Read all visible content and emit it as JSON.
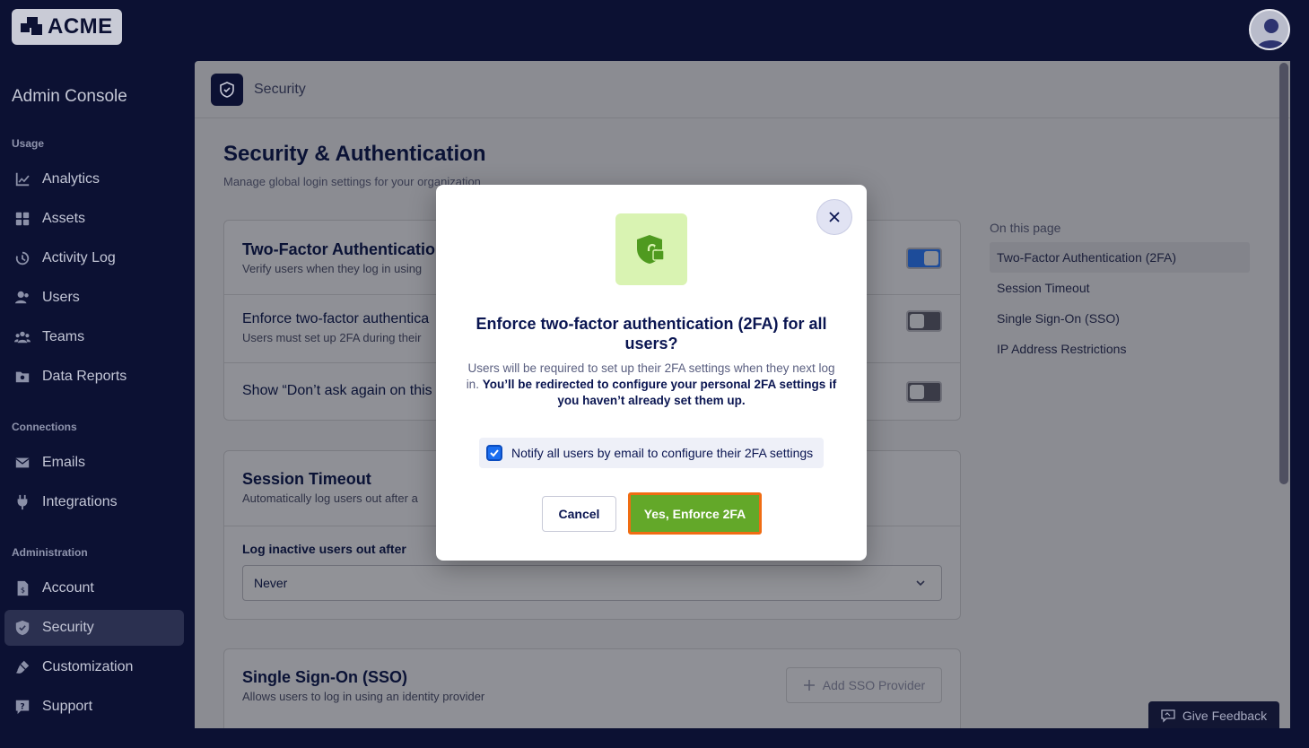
{
  "brand": {
    "logo_text": "ACME"
  },
  "sidebar": {
    "title": "Admin Console",
    "sections": [
      {
        "label": "Usage"
      },
      {
        "label": "Connections"
      },
      {
        "label": "Administration"
      }
    ],
    "items": [
      {
        "label": "Analytics",
        "icon": "chart-line-icon"
      },
      {
        "label": "Assets",
        "icon": "grid-icon"
      },
      {
        "label": "Activity Log",
        "icon": "history-icon"
      },
      {
        "label": "Users",
        "icon": "user-icon"
      },
      {
        "label": "Teams",
        "icon": "team-icon"
      },
      {
        "label": "Data Reports",
        "icon": "report-icon"
      },
      {
        "label": "Emails",
        "icon": "mail-icon"
      },
      {
        "label": "Integrations",
        "icon": "plug-icon"
      },
      {
        "label": "Account",
        "icon": "document-icon"
      },
      {
        "label": "Security",
        "icon": "shield-icon",
        "active": true
      },
      {
        "label": "Customization",
        "icon": "brush-icon"
      },
      {
        "label": "Support",
        "icon": "help-icon"
      }
    ]
  },
  "main": {
    "header_title": "Security",
    "page_title": "Security & Authentication",
    "page_subtitle": "Manage global login settings for your organization",
    "tfa": {
      "title": "Two-Factor Authentication",
      "subtitle": "Verify users when they log in using",
      "enforce_title": "Enforce two-factor authentica",
      "enforce_sub": "Users must set up 2FA during their",
      "show_title": "Show “Don’t ask again on this"
    },
    "session": {
      "title": "Session Timeout",
      "subtitle": "Automatically log users out after a",
      "field_label": "Log inactive users out after",
      "field_value": "Never"
    },
    "sso": {
      "title": "Single Sign-On (SSO)",
      "subtitle": "Allows users to log in using an identity provider",
      "add_button": "Add SSO Provider"
    }
  },
  "toc": {
    "label": "On this page",
    "items": [
      "Two-Factor Authentication (2FA)",
      "Session Timeout",
      "Single Sign-On (SSO)",
      "IP Address Restrictions"
    ]
  },
  "feedback": {
    "label": "Give Feedback"
  },
  "modal": {
    "title": "Enforce two-factor authentication (2FA) for all users?",
    "text_plain": "Users will be required to set up their 2FA settings when they next log in.",
    "text_bold": "You’ll be redirected to configure your personal 2FA settings if you haven’t already set them up.",
    "notify_label": "Notify all users by email to configure their 2FA settings",
    "notify_checked": true,
    "cancel_label": "Cancel",
    "confirm_label": "Yes, Enforce 2FA"
  },
  "colors": {
    "accent_green": "#63a829",
    "highlight_orange": "#f06c12",
    "checkbox_blue": "#1a6ef0",
    "navy": "#0a1551"
  }
}
